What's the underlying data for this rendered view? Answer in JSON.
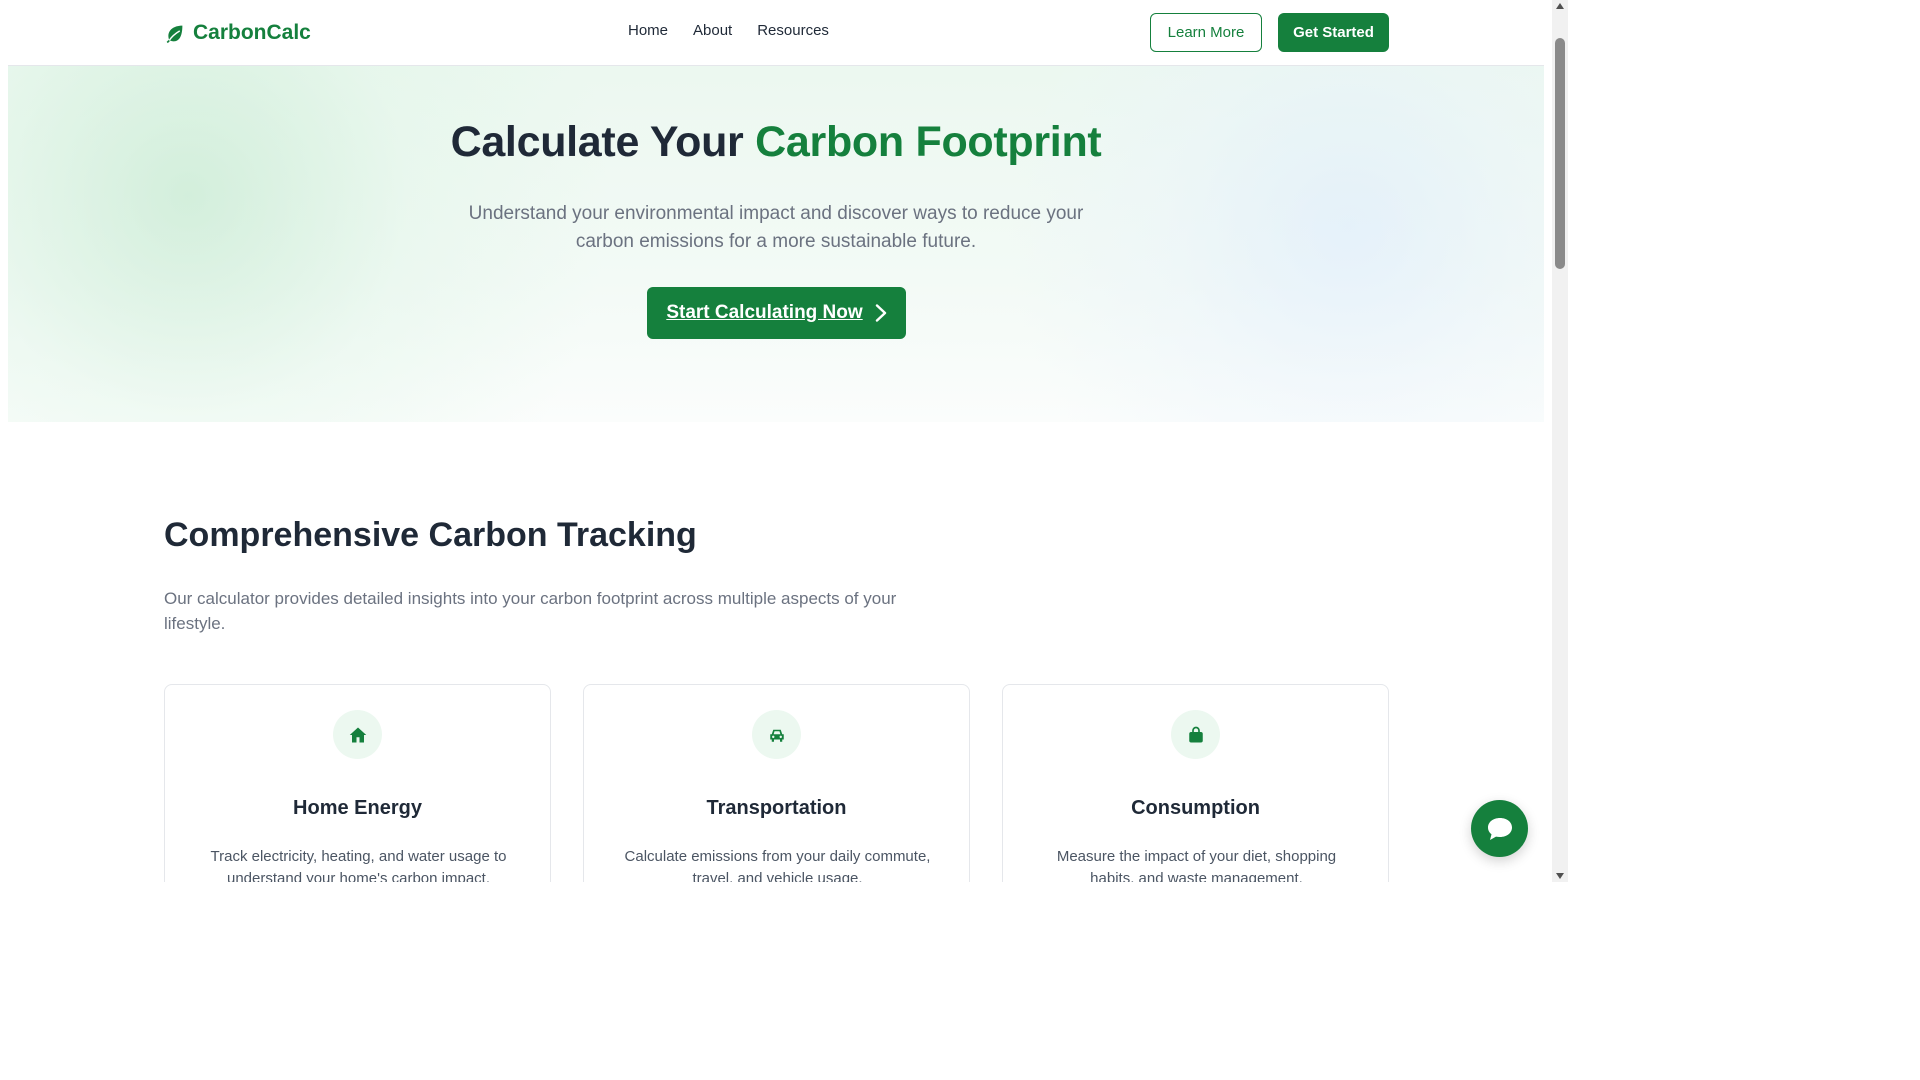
{
  "brand": {
    "name": "CarbonCalc",
    "color": "#15803d",
    "icon": "leaf-icon"
  },
  "nav": {
    "items": [
      "Home",
      "About",
      "Resources"
    ]
  },
  "header_buttons": {
    "learn_more": "Learn More",
    "get_started": "Get Started"
  },
  "hero": {
    "title_prefix": "Calculate Your ",
    "title_accent": "Carbon Footprint",
    "subtitle": "Understand your environmental impact and discover ways to reduce your carbon emissions for a more sustainable future.",
    "cta_label": "Start Calculating Now",
    "cta_icon": "chevron-right-icon"
  },
  "section": {
    "title": "Comprehensive Carbon Tracking",
    "description": "Our calculator provides detailed insights into your carbon footprint across multiple aspects of your lifestyle."
  },
  "cards": [
    {
      "icon": "home-icon",
      "title": "Home Energy",
      "description": "Track electricity, heating, and water usage to understand your home's carbon impact."
    },
    {
      "icon": "car-icon",
      "title": "Transportation",
      "description": "Calculate emissions from your daily commute, travel, and vehicle usage."
    },
    {
      "icon": "shopping-bag-icon",
      "title": "Consumption",
      "description": "Measure the impact of your diet, shopping habits, and waste management."
    }
  ],
  "chat": {
    "icon": "chat-bubble-icon"
  }
}
